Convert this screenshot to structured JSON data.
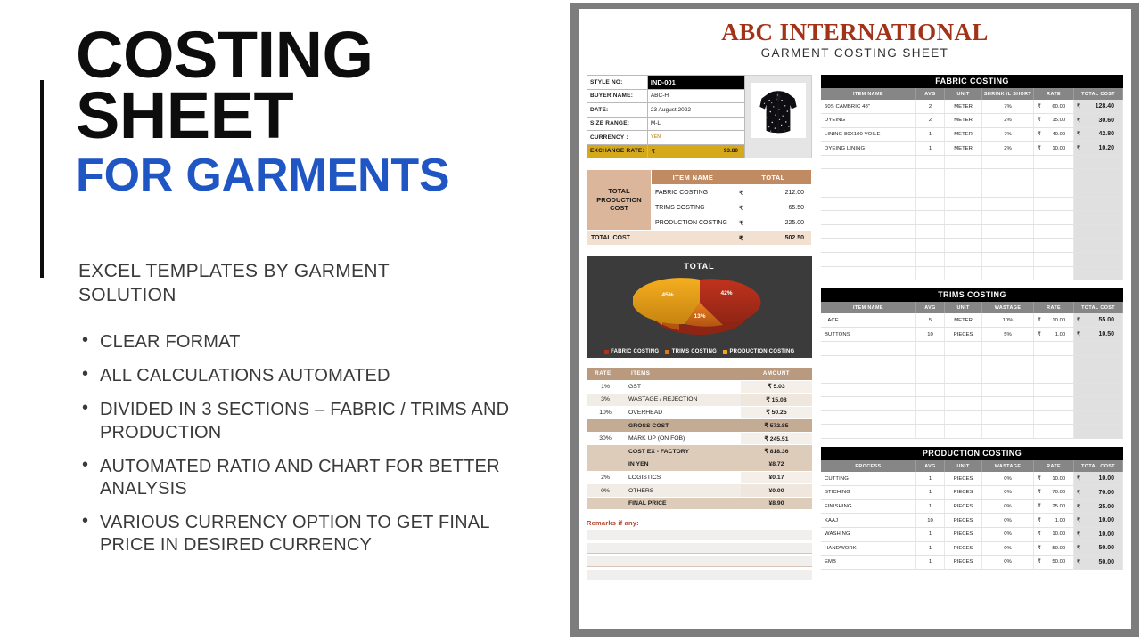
{
  "slide": {
    "title_line1": "COSTING",
    "title_line2": "SHEET",
    "title_sub": "FOR GARMENTS",
    "subtitle": "EXCEL TEMPLATES BY GARMENT SOLUTION",
    "accent_color": "#1f56c3",
    "bullets": [
      "CLEAR FORMAT",
      "ALL CALCULATIONS AUTOMATED",
      "DIVIDED IN 3 SECTIONS – FABRIC / TRIMS AND PRODUCTION",
      "AUTOMATED RATIO AND CHART FOR BETTER ANALYSIS",
      "VARIOUS CURRENCY OPTION TO GET FINAL PRICE IN DESIRED CURRENCY"
    ]
  },
  "sheet": {
    "company": "ABC INTERNATIONAL",
    "subtitle": "GARMENT COSTING SHEET",
    "company_color": "#a23318",
    "style_info": [
      {
        "label": "STYLE  NO:",
        "value": "IND-001"
      },
      {
        "label": "BUYER  NAME:",
        "value": "ABC-H"
      },
      {
        "label": "DATE:",
        "value": "23 August 2022"
      },
      {
        "label": "SIZE  RANGE:",
        "value": "M-L"
      },
      {
        "label": "CURRENCY :",
        "value": "YEN"
      }
    ],
    "exchange": {
      "label": "EXCHANGE RATE:",
      "symbol": "₹",
      "value": "93.80"
    },
    "garment_image_alt": "black floral printed jacket",
    "total_production": {
      "label": "TOTAL\nPRODUCTION COST",
      "label_line1": "TOTAL",
      "label_line2": "PRODUCTION COST",
      "headers": [
        "ITEM NAME",
        "TOTAL"
      ],
      "rows": [
        {
          "name": "FABRIC COSTING",
          "symbol": "₹",
          "amount": "212.00"
        },
        {
          "name": "TRIMS COSTING",
          "symbol": "₹",
          "amount": "65.50"
        },
        {
          "name": "PRODUCTION COSTING",
          "symbol": "₹",
          "amount": "225.00"
        },
        {
          "name": "TOTAL COST",
          "symbol": "₹",
          "amount": "502.50"
        }
      ]
    },
    "rate_table": {
      "headers": [
        "RATE",
        "ITEMS",
        "AMOUNT"
      ],
      "rows": [
        {
          "rate": "1%",
          "item": "GST",
          "amount": "₹ 5.03",
          "style": "band-a"
        },
        {
          "rate": "3%",
          "item": "WASTAGE / REJECTION",
          "amount": "₹ 15.08",
          "style": "band-a"
        },
        {
          "rate": "10%",
          "item": "OVERHEAD",
          "amount": "₹ 50.25",
          "style": "band-a"
        },
        {
          "rate": "",
          "item": "GROSS COST",
          "amount": "₹ 572.85",
          "style": "band-hl"
        },
        {
          "rate": "30%",
          "item": "MARK UP (ON FOB)",
          "amount": "₹ 245.51",
          "style": "band-a"
        },
        {
          "rate": "",
          "item": "COST EX - FACTORY",
          "amount": "₹ 818.36",
          "style": "band-hl2"
        },
        {
          "rate": "",
          "item": "IN YEN",
          "amount": "¥8.72",
          "style": "band-hl2"
        },
        {
          "rate": "2%",
          "item": "LOGISTICS",
          "amount": "¥0.17",
          "style": "band-a"
        },
        {
          "rate": "0%",
          "item": "OTHERS",
          "amount": "¥0.00",
          "style": "band-a"
        },
        {
          "rate": "",
          "item": "FINAL PRICE",
          "amount": "¥8.90",
          "style": "band-hl2"
        }
      ]
    },
    "remarks_label": "Remarks if any:",
    "remarks_lines": 4,
    "fabric_costing": {
      "title": "FABRIC COSTING",
      "headers": [
        "ITEM NAME",
        "AVG",
        "UNIT",
        "SHRINK /L SHORT",
        "RATE",
        "TOTAL COST"
      ],
      "rows": [
        {
          "name": "60S CAMBRIC 48\"",
          "avg": "2",
          "unit": "METER",
          "wastage": "7%",
          "rate_sym": "₹",
          "rate": "60.00",
          "total_sym": "₹",
          "total": "128.40"
        },
        {
          "name": "DYEING",
          "avg": "2",
          "unit": "METER",
          "wastage": "2%",
          "rate_sym": "₹",
          "rate": "15.00",
          "total_sym": "₹",
          "total": "30.60"
        },
        {
          "name": "LINING 80X100 VOILE",
          "avg": "1",
          "unit": "METER",
          "wastage": "7%",
          "rate_sym": "₹",
          "rate": "40.00",
          "total_sym": "₹",
          "total": "42.80"
        },
        {
          "name": "DYEING LINING",
          "avg": "1",
          "unit": "METER",
          "wastage": "2%",
          "rate_sym": "₹",
          "rate": "10.00",
          "total_sym": "₹",
          "total": "10.20"
        }
      ],
      "filler_rows": 9
    },
    "trims_costing": {
      "title": "TRIMS COSTING",
      "headers": [
        "ITEM NAME",
        "AVG",
        "UNIT",
        "WASTAGE",
        "RATE",
        "TOTAL COST"
      ],
      "rows": [
        {
          "name": "LACE",
          "avg": "5",
          "unit": "METER",
          "wastage": "10%",
          "rate_sym": "₹",
          "rate": "10.00",
          "total_sym": "₹",
          "total": "55.00"
        },
        {
          "name": "BUTTONS",
          "avg": "10",
          "unit": "PIECES",
          "wastage": "5%",
          "rate_sym": "₹",
          "rate": "1.00",
          "total_sym": "₹",
          "total": "10.50"
        }
      ],
      "filler_rows": 7
    },
    "production_costing": {
      "title": "PRODUCTION COSTING",
      "headers": [
        "PROCESS",
        "AVG",
        "UNIT",
        "WASTAGE",
        "RATE",
        "TOTAL COST"
      ],
      "rows": [
        {
          "name": "CUTTING",
          "avg": "1",
          "unit": "PIECES",
          "wastage": "0%",
          "rate_sym": "₹",
          "rate": "10.00",
          "total_sym": "₹",
          "total": "10.00"
        },
        {
          "name": "STICHING",
          "avg": "1",
          "unit": "PIECES",
          "wastage": "0%",
          "rate_sym": "₹",
          "rate": "70.00",
          "total_sym": "₹",
          "total": "70.00"
        },
        {
          "name": "FINISHING",
          "avg": "1",
          "unit": "PIECES",
          "wastage": "0%",
          "rate_sym": "₹",
          "rate": "25.00",
          "total_sym": "₹",
          "total": "25.00"
        },
        {
          "name": "KAAJ",
          "avg": "10",
          "unit": "PIECES",
          "wastage": "0%",
          "rate_sym": "₹",
          "rate": "1.00",
          "total_sym": "₹",
          "total": "10.00"
        },
        {
          "name": "WASHING",
          "avg": "1",
          "unit": "PIECES",
          "wastage": "0%",
          "rate_sym": "₹",
          "rate": "10.00",
          "total_sym": "₹",
          "total": "10.00"
        },
        {
          "name": "HANDWORK",
          "avg": "1",
          "unit": "PIECES",
          "wastage": "0%",
          "rate_sym": "₹",
          "rate": "50.00",
          "total_sym": "₹",
          "total": "50.00"
        },
        {
          "name": "EMB",
          "avg": "1",
          "unit": "PIECES",
          "wastage": "0%",
          "rate_sym": "₹",
          "rate": "50.00",
          "total_sym": "₹",
          "total": "50.00"
        }
      ],
      "filler_rows": 0
    }
  },
  "chart_data": {
    "type": "pie",
    "title": "TOTAL",
    "categories": [
      "FABRIC COSTING",
      "TRIMS COSTING",
      "PRODUCTION COSTING"
    ],
    "values": [
      212.0,
      65.5,
      225.0
    ],
    "percent_labels": [
      "42%",
      "13%",
      "45%"
    ],
    "colors": [
      "#b4301c",
      "#e2761b",
      "#f2a71b"
    ],
    "legend_position": "bottom",
    "background": "#3b3b3b",
    "label_color": "#ffffff"
  }
}
